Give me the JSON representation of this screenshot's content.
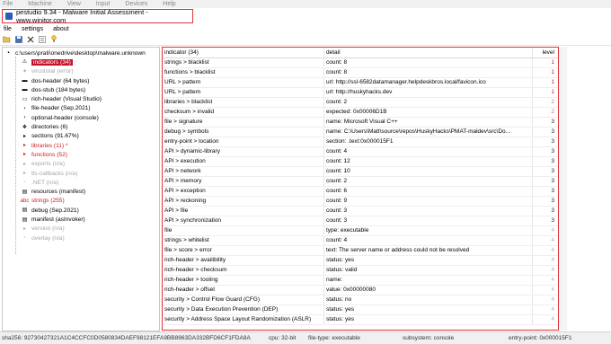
{
  "vm_menu": [
    "File",
    "Machine",
    "View",
    "Input",
    "Devices",
    "Help"
  ],
  "window": {
    "title": "pestudio 9.34 - Malware Initial Assessment - www.winitor.com"
  },
  "menu": [
    "file",
    "settings",
    "about"
  ],
  "toolbar_icons": [
    "open-folder-icon",
    "save-icon",
    "close-icon",
    "options-icon",
    "help-icon"
  ],
  "tree": [
    {
      "label": "c:\\users\\prati\\onedrive\\desktop\\malware.unknown",
      "color": "black",
      "icon": "file-icon"
    },
    {
      "label": "indicators (34)",
      "color": "selected",
      "icon": "indicators-icon"
    },
    {
      "label": "virustotal (error)",
      "color": "gray",
      "icon": "virustotal-icon"
    },
    {
      "label": "dos-header (64 bytes)",
      "color": "black",
      "icon": "dos-header-icon"
    },
    {
      "label": "dos-stub (184 bytes)",
      "color": "black",
      "icon": "dos-stub-icon"
    },
    {
      "label": "rich-header (Visual Studio)",
      "color": "black",
      "icon": "rich-header-icon"
    },
    {
      "label": "file-header (Sep.2021)",
      "color": "black",
      "icon": "file-header-icon"
    },
    {
      "label": "optional-header (console)",
      "color": "black",
      "icon": "optional-header-icon"
    },
    {
      "label": "directories (6)",
      "color": "black",
      "icon": "directories-icon"
    },
    {
      "label": "sections (91.67%)",
      "color": "black",
      "icon": "sections-icon"
    },
    {
      "label": "libraries (11) *",
      "color": "red",
      "icon": "libraries-icon"
    },
    {
      "label": "functions (52)",
      "color": "red",
      "icon": "functions-icon"
    },
    {
      "label": "exports (n/a)",
      "color": "gray",
      "icon": "exports-icon"
    },
    {
      "label": "tls-callbacks (n/a)",
      "color": "gray",
      "icon": "tls-callbacks-icon"
    },
    {
      "label": ".NET (n/a)",
      "color": "gray",
      "icon": "dotnet-icon"
    },
    {
      "label": "resources (manifest)",
      "color": "black",
      "icon": "resources-icon"
    },
    {
      "label": "strings (255)",
      "color": "red",
      "icon": "strings-icon"
    },
    {
      "label": "debug (Sep.2021)",
      "color": "black",
      "icon": "debug-icon"
    },
    {
      "label": "manifest (asInvoker)",
      "color": "black",
      "icon": "manifest-icon"
    },
    {
      "label": "version (n/a)",
      "color": "gray",
      "icon": "version-icon"
    },
    {
      "label": "overlay (n/a)",
      "color": "gray",
      "icon": "overlay-icon"
    }
  ],
  "grid": {
    "headers": [
      "indicator (34)",
      "detail",
      "level"
    ],
    "rows": [
      [
        "strings > blacklist",
        "count: 8",
        "1"
      ],
      [
        "functions > blacklist",
        "count: 8",
        "1"
      ],
      [
        "URL > pattern",
        "url: http://ssl-6582datamanager.helpdeskbros.local/favicon.ico",
        "1"
      ],
      [
        "URL > pattern",
        "url: http://huskyhacks.dev",
        "1"
      ],
      [
        "libraries > blacklist",
        "count: 2",
        "2"
      ],
      [
        "checksum > invalid",
        "expected: 0x00006D1B",
        "2"
      ],
      [
        "file > signature",
        "name: Microsoft Visual C++",
        "3"
      ],
      [
        "debug > symbols",
        "name: C:\\Users\\Matt\\source\\repos\\HuskyHacks\\PMAT-maldev\\src\\Do...",
        "3"
      ],
      [
        "entry-point > location",
        "section: .text:0x000015F1",
        "3"
      ],
      [
        "API > dynamic-library",
        "count: 4",
        "3"
      ],
      [
        "API > execution",
        "count: 12",
        "3"
      ],
      [
        "API > network",
        "count: 10",
        "3"
      ],
      [
        "API > memory",
        "count: 2",
        "3"
      ],
      [
        "API > exception",
        "count: 6",
        "3"
      ],
      [
        "API > reckoning",
        "count: 9",
        "3"
      ],
      [
        "API > file",
        "count: 3",
        "3"
      ],
      [
        "API > synchronization",
        "count: 3",
        "3"
      ],
      [
        "file",
        "type: executable",
        "4"
      ],
      [
        "strings > whitelist",
        "count: 4",
        "4"
      ],
      [
        "file > score > error",
        "text: The server name or address could not be resolved",
        "4"
      ],
      [
        "rich-header > availibility",
        "status: yes",
        "4"
      ],
      [
        "rich-header > checksum",
        "status: valid",
        "4"
      ],
      [
        "rich-header > tooling",
        "name:",
        "4"
      ],
      [
        "rich-header > offset",
        "value: 0x00000080",
        "4"
      ],
      [
        "security > Control Flow Guard (CFG)",
        "status: no",
        "4"
      ],
      [
        "security > Data Execution Prevention (DEP)",
        "status: yes",
        "4"
      ],
      [
        "security > Address Space Layout Randomization (ASLR)",
        "status: yes",
        "4"
      ]
    ]
  },
  "status": {
    "sha256": "sha256: 92730427321A1C4CCFC0D0580834DAEF98121EFA9BB8963DA332BFD6CF1FDA8A",
    "cpu": "cpu: 32-bit",
    "file_type": "file-type: executable",
    "subsystem": "subsystem: console",
    "entry_point": "entry-point: 0x000015F1"
  },
  "colors": {
    "accent_red": "#e2323b",
    "selection": "#c5122b",
    "level1": "#c0162b",
    "level2": "#e0703a"
  }
}
